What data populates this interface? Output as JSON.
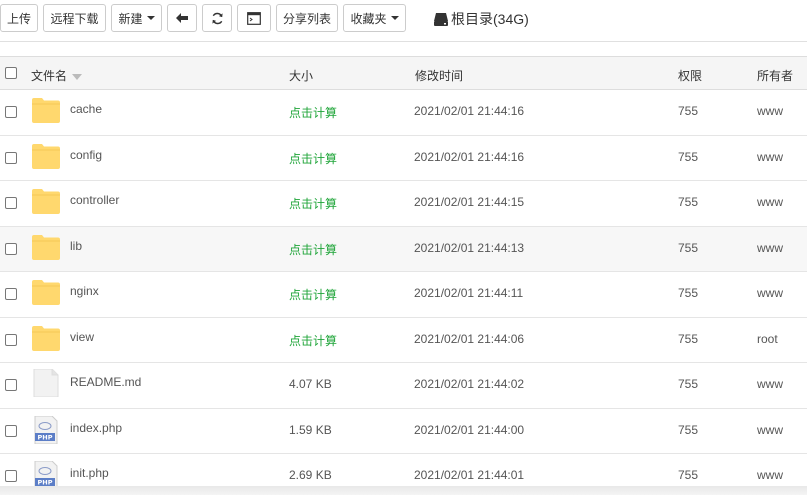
{
  "toolbar": {
    "upload": "上传",
    "remote_download": "远程下载",
    "new": "新建",
    "share_list": "分享列表",
    "favorites": "收藏夹",
    "path": "根目录(34G)"
  },
  "table": {
    "headers": {
      "name": "文件名",
      "size": "大小",
      "modified": "修改时间",
      "permission": "权限",
      "owner": "所有者"
    },
    "rows": [
      {
        "type": "folder",
        "name": "cache",
        "size": "点击计算",
        "modified": "2021/02/01 21:44:16",
        "perm": "755",
        "owner": "www"
      },
      {
        "type": "folder",
        "name": "config",
        "size": "点击计算",
        "modified": "2021/02/01 21:44:16",
        "perm": "755",
        "owner": "www"
      },
      {
        "type": "folder",
        "name": "controller",
        "size": "点击计算",
        "modified": "2021/02/01 21:44:15",
        "perm": "755",
        "owner": "www"
      },
      {
        "type": "folder",
        "name": "lib",
        "size": "点击计算",
        "modified": "2021/02/01 21:44:13",
        "perm": "755",
        "owner": "www"
      },
      {
        "type": "folder",
        "name": "nginx",
        "size": "点击计算",
        "modified": "2021/02/01 21:44:11",
        "perm": "755",
        "owner": "www"
      },
      {
        "type": "folder",
        "name": "view",
        "size": "点击计算",
        "modified": "2021/02/01 21:44:06",
        "perm": "755",
        "owner": "root"
      },
      {
        "type": "file",
        "name": "README.md",
        "size": "4.07 KB",
        "modified": "2021/02/01 21:44:02",
        "perm": "755",
        "owner": "www"
      },
      {
        "type": "php",
        "name": "index.php",
        "size": "1.59 KB",
        "modified": "2021/02/01 21:44:00",
        "perm": "755",
        "owner": "www"
      },
      {
        "type": "php",
        "name": "init.php",
        "size": "2.69 KB",
        "modified": "2021/02/01 21:44:01",
        "perm": "755",
        "owner": "www"
      }
    ],
    "highlighted_row": 3
  },
  "icons": {
    "back": "arrow-left-icon",
    "refresh": "refresh-icon",
    "terminal": "terminal-icon",
    "disk": "hdd-icon",
    "folder_color": "#ffd86e",
    "calc_color": "#20a53a"
  }
}
